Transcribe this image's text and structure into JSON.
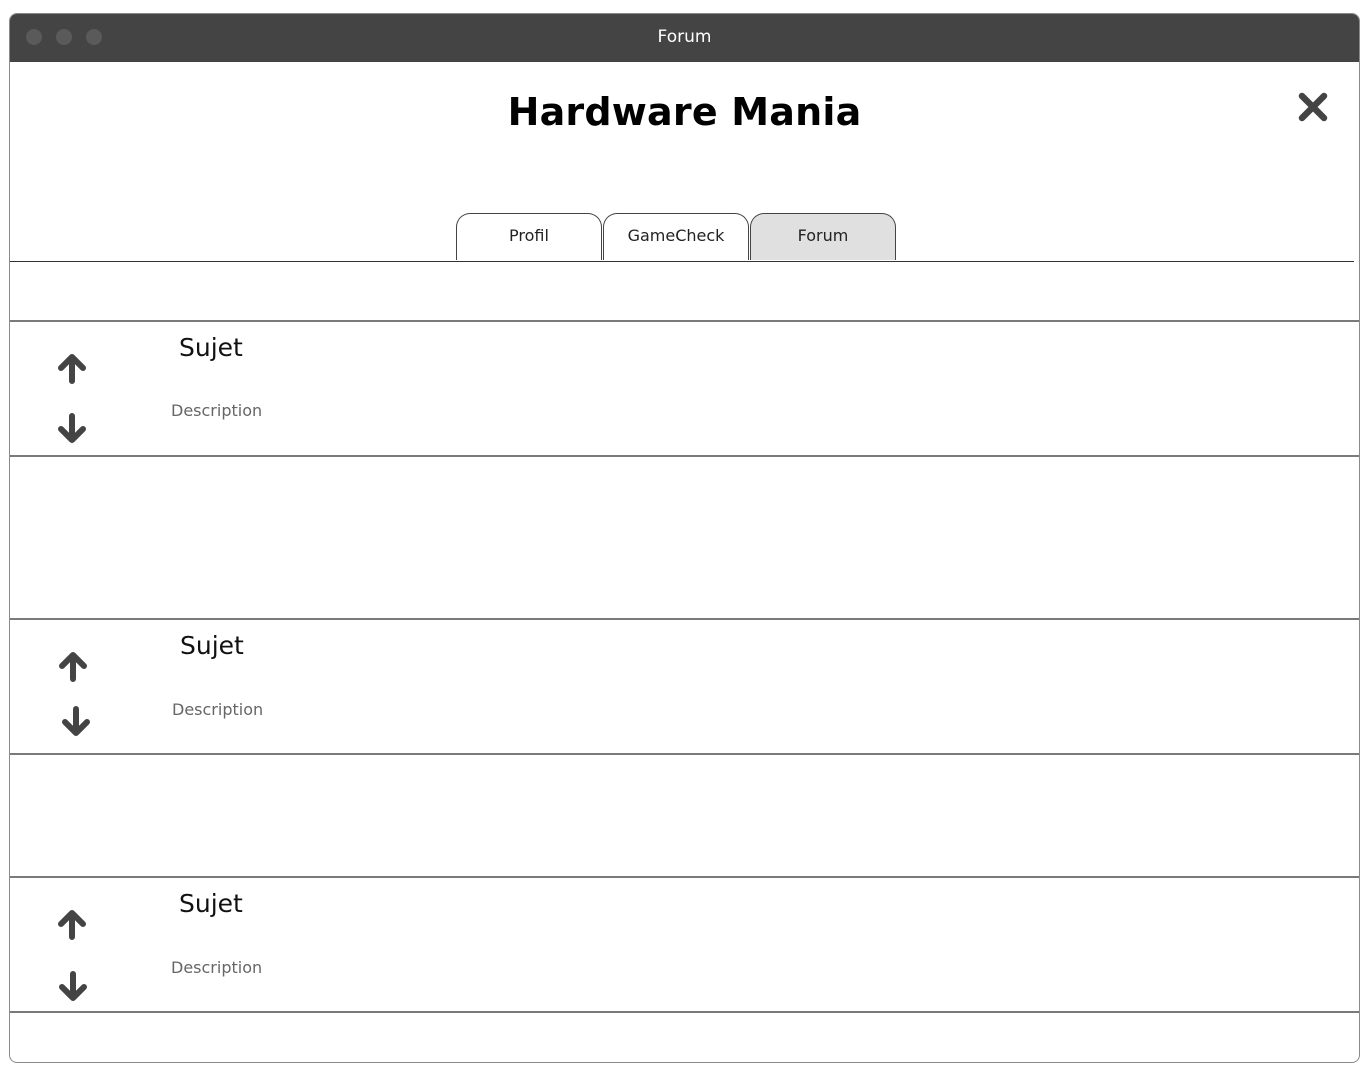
{
  "window": {
    "title": "Forum"
  },
  "app": {
    "title": "Hardware Mania"
  },
  "icons": {
    "close": "close-icon",
    "upvote": "arrow-up-icon",
    "downvote": "arrow-down-icon"
  },
  "colors": {
    "titlebar": "#444444",
    "active_tab": "#e0e0e0",
    "icon": "#444444"
  },
  "tabs": [
    {
      "label": "Profil",
      "active": false
    },
    {
      "label": "GameCheck",
      "active": false
    },
    {
      "label": "Forum",
      "active": true
    }
  ],
  "posts": [
    {
      "subject": "Sujet",
      "description": "Description"
    },
    {
      "subject": "Sujet",
      "description": "Description"
    },
    {
      "subject": "Sujet",
      "description": "Description"
    }
  ]
}
